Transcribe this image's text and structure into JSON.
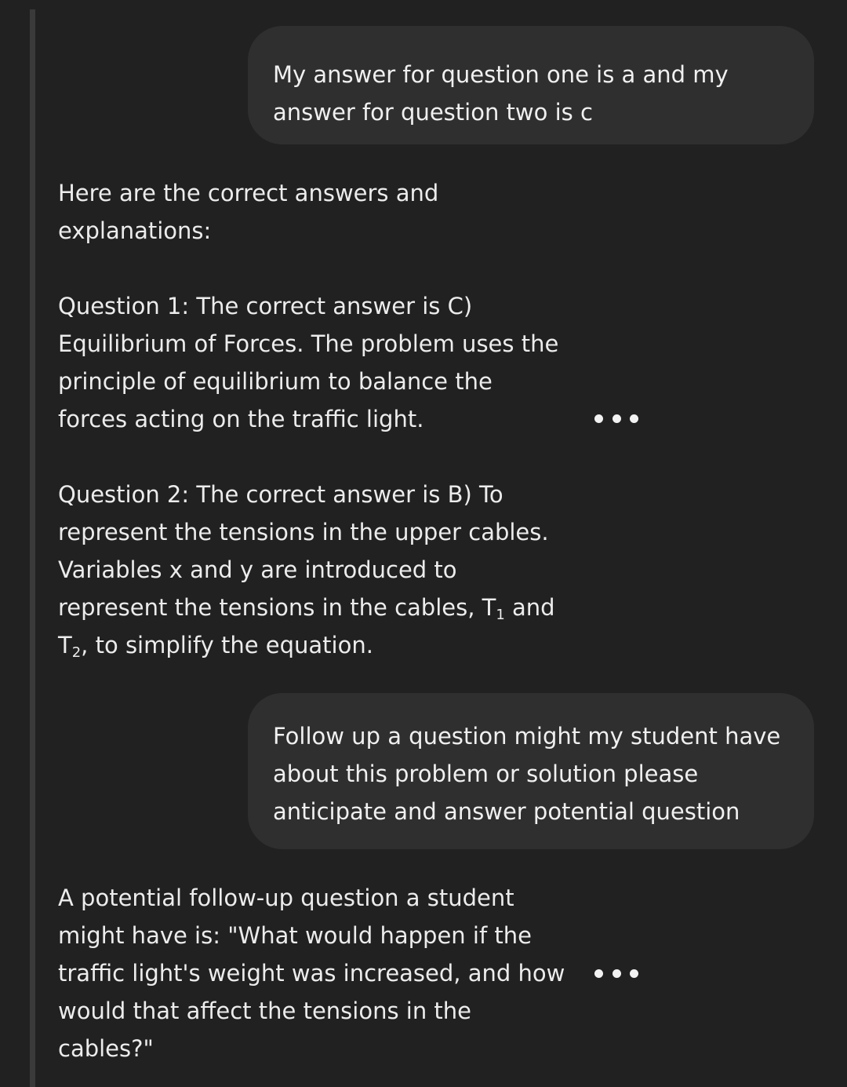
{
  "conversation": {
    "user_messages": [
      {
        "lines": [
          "My answer for question one is a and my",
          "answer for question two is c"
        ]
      },
      {
        "lines": [
          "Follow up a question might my student have",
          "about this problem or solution please",
          "anticipate and answer potential question"
        ]
      }
    ],
    "assistant_intro": {
      "lines": [
        "Here are the correct answers and",
        "explanations:"
      ]
    },
    "assistant_q1": {
      "lines": [
        "Question 1: The correct answer is C)",
        "Equilibrium of Forces. The problem uses the",
        "principle of equilibrium to balance the",
        "forces acting on the traffic light."
      ]
    },
    "assistant_q2": {
      "line1": "Question 2: The correct answer is B) To",
      "line2": "represent the tensions in the upper cables.",
      "line3": "Variables x and y are introduced to",
      "line4_prefix": "represent the tensions in the cables, T",
      "t1_sub": "1",
      "line4_suffix": " and",
      "line5_prefix": "T",
      "t2_sub": "2",
      "line5_suffix": ", to simplify the equation."
    },
    "assistant_followup": {
      "lines": [
        "A potential follow-up question a student",
        "might have is: \"What would happen if the",
        "traffic light's weight was increased, and how",
        "would that affect the tensions in the",
        "cables?\""
      ]
    },
    "more_options_icon": "more-horizontal-icon"
  }
}
